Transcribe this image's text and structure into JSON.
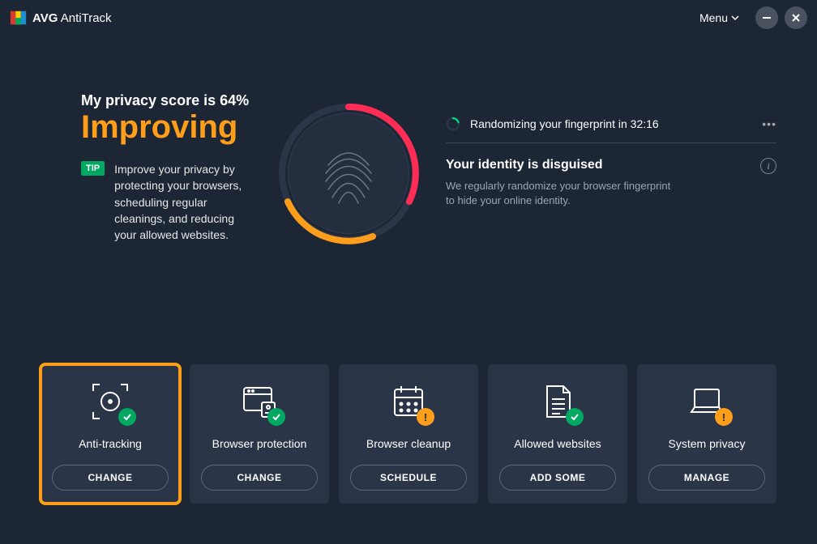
{
  "app": {
    "brand": "AVG",
    "product": "AntiTrack"
  },
  "titlebar": {
    "menu_label": "Menu"
  },
  "privacy": {
    "score_line": "My privacy score is 64%",
    "status": "Improving",
    "tip_badge": "TIP",
    "tip_text": "Improve your privacy by protecting your browsers, scheduling regular cleanings, and reducing your allowed websites."
  },
  "randomize": {
    "line": "Randomizing your fingerprint in 32:16"
  },
  "identity": {
    "title": "Your identity is disguised",
    "desc": "We regularly randomize your browser fingerprint to hide your online identity."
  },
  "cards": [
    {
      "id": "anti-tracking",
      "title": "Anti-tracking",
      "button": "CHANGE",
      "badge": "ok"
    },
    {
      "id": "browser-protection",
      "title": "Browser protection",
      "button": "CHANGE",
      "badge": "ok"
    },
    {
      "id": "browser-cleanup",
      "title": "Browser cleanup",
      "button": "SCHEDULE",
      "badge": "warn"
    },
    {
      "id": "allowed-websites",
      "title": "Allowed websites",
      "button": "ADD SOME",
      "badge": "ok"
    },
    {
      "id": "system-privacy",
      "title": "System privacy",
      "button": "MANAGE",
      "badge": "warn"
    }
  ]
}
